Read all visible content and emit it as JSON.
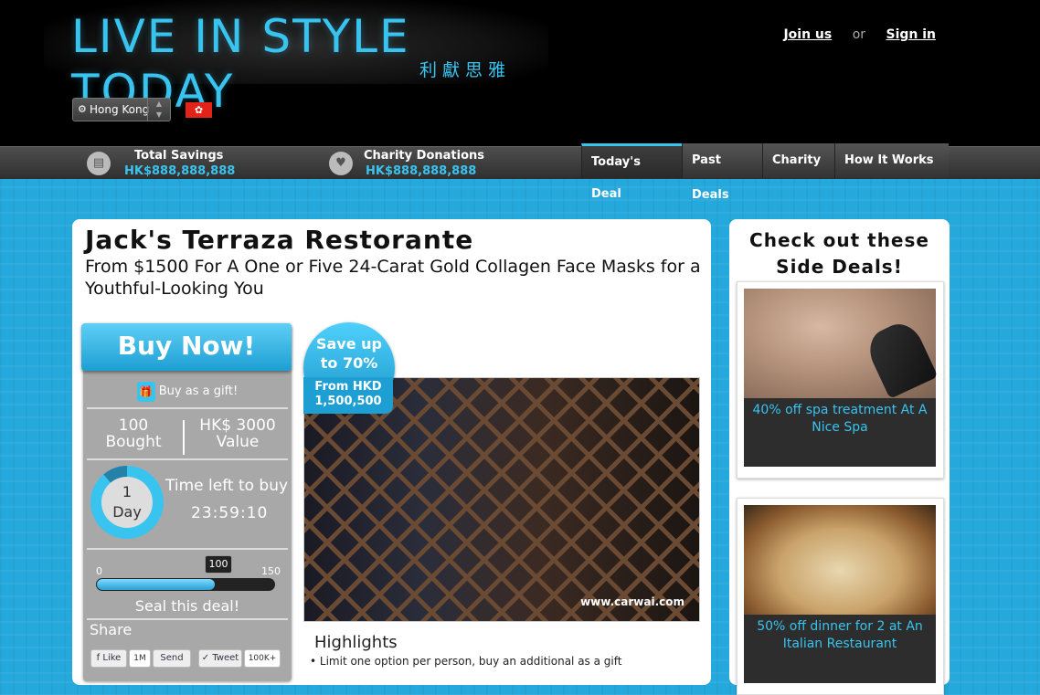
{
  "header": {
    "logo_text": "LIVE IN STYLE TODAY",
    "logo_subtitle": "利獻思雅",
    "join_label": "Join us",
    "or_label": "or",
    "signin_label": "Sign in",
    "city": "Hong Kong",
    "flag_icon": "hk-flag-icon"
  },
  "stats": {
    "savings_title": "Total Savings",
    "savings_value": "HK$888,888,888",
    "donations_title": "Charity Donations",
    "donations_value": "HK$888,888,888"
  },
  "nav": {
    "items": [
      "Today's Deal",
      "Past Deals",
      "Charity",
      "How It Works"
    ],
    "active": "Today's Deal"
  },
  "deal": {
    "title": "Jack's Terraza Restorante",
    "subtitle": "From $1500 For A One or Five 24-Carat Gold Collagen Face Masks for a Youthful-Looking You",
    "buy_label": "Buy Now!",
    "gift_label": "Buy as a gift!",
    "bought_count": "100",
    "bought_label": "Bought",
    "value_amount": "HK$ 3000",
    "value_label": "Value",
    "timer_number": "1",
    "timer_unit": "Day",
    "time_left_label": "Time left to buy",
    "time_left_value": "23:59:10",
    "progress_min": "0",
    "progress_max": "150",
    "progress_current": "100",
    "progress_fraction": 0.6667,
    "seal_label": "Seal this deal!",
    "share_label": "Share",
    "like_label": "Like",
    "like_count": "1M",
    "send_label": "Send",
    "tweet_label": "Tweet",
    "tweet_count": "100K+",
    "badge_line1": "Save up",
    "badge_line2": "to 70%",
    "badge_line3": "From HKD",
    "badge_line4": "1,500,500",
    "photo_credit": "www.carwai.com",
    "highlights_title": "Highlights",
    "highlight_1": "Limit one option per person, buy an additional as a gift"
  },
  "side": {
    "title_line1": "Check out these",
    "title_line2": "Side Deals!",
    "deals": [
      {
        "caption": "40% off spa treatment At A Nice Spa"
      },
      {
        "caption": "50% off dinner for 2 at An Italian Restaurant"
      }
    ]
  },
  "colors": {
    "accent": "#39c3ef",
    "background": "#25a9dc",
    "header": "#000000"
  }
}
